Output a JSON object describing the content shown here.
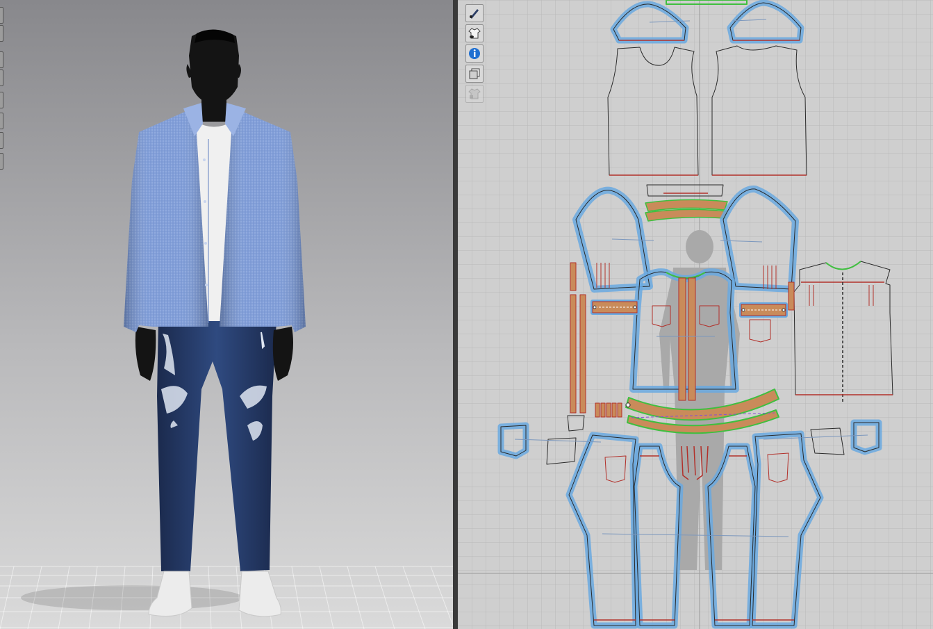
{
  "colors": {
    "view3d_top": "#8a8a8e",
    "view3d_bottom": "#d8d8d8",
    "view2d_bg": "#cfcfcf",
    "grid": "#b8b8b8",
    "pattern_highlight": "#6aa9e0",
    "pattern_line": "#2a2a2a",
    "seam_red": "#b2302a",
    "seam_green": "#3fbf3f",
    "trim_fill": "#c98b5a",
    "shirt": "#7e9bd8",
    "jeans": "#263a66",
    "avatar": "#141414",
    "tshirt": "#f2f2f2",
    "sneakers": "#eeeeee"
  },
  "toolbar2d": {
    "items": [
      {
        "icon": "brush-eye-icon",
        "state": "active"
      },
      {
        "icon": "shirt-eye-icon",
        "state": "active"
      },
      {
        "icon": "info-icon",
        "state": "active"
      },
      {
        "icon": "layer-pieces-icon",
        "state": "active"
      },
      {
        "icon": "shirt-lock-icon",
        "state": "disabled"
      }
    ]
  },
  "edge_tools": {
    "count": 8
  }
}
